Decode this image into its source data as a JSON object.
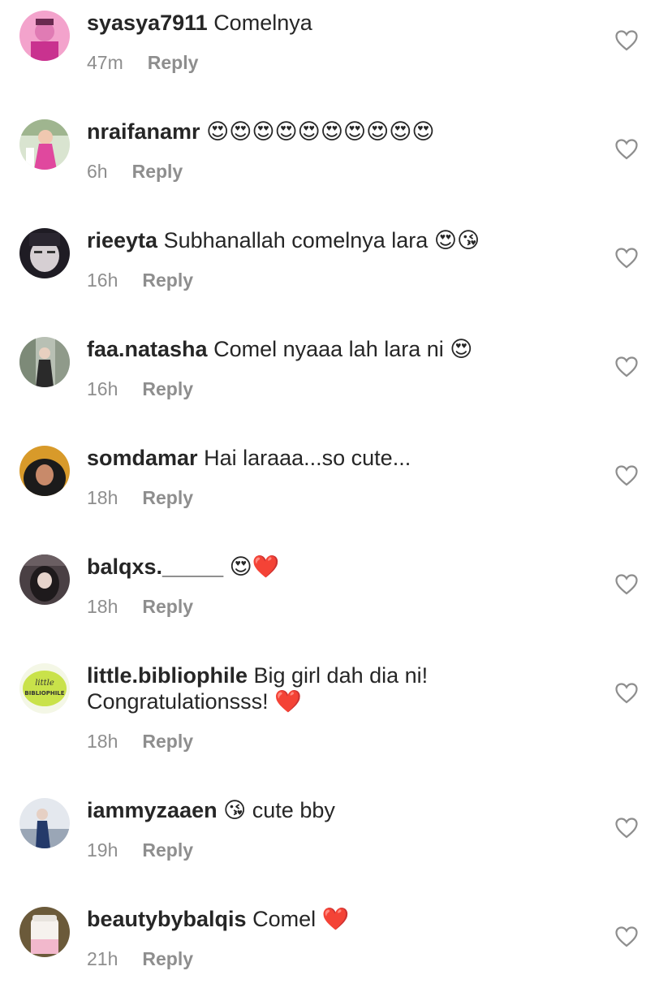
{
  "comments": [
    {
      "username": "syasya7911",
      "text": "Comelnya",
      "emoji": "",
      "time": "47m",
      "reply": "Reply",
      "avatar_color": "#d84fa8"
    },
    {
      "username": "nraifanamr",
      "text": "",
      "emoji": "😍😍😍😍😍😍😍😍😍😍",
      "time": "6h",
      "reply": "Reply",
      "avatar_color": "#c94b8c"
    },
    {
      "username": "rieeyta",
      "text": "Subhanallah comelnya lara",
      "emoji": "😍😘",
      "time": "16h",
      "reply": "Reply",
      "avatar_color": "#2d2a33"
    },
    {
      "username": "faa.natasha",
      "text": "Comel nyaaa lah lara ni",
      "emoji": "😍",
      "time": "16h",
      "reply": "Reply",
      "avatar_color": "#6d7a6a"
    },
    {
      "username": "somdamar",
      "text": "Hai laraaa...so cute...",
      "emoji": "",
      "time": "18h",
      "reply": "Reply",
      "avatar_color": "#c18d2a"
    },
    {
      "username": "balqxs._____",
      "text": "",
      "emoji": "😍❤️",
      "time": "18h",
      "reply": "Reply",
      "avatar_color": "#3b3134"
    },
    {
      "username": "little.bibliophile",
      "text": "Big girl dah dia ni!",
      "text2": "Congratulationsss!",
      "emoji": "❤️",
      "time": "18h",
      "reply": "Reply",
      "avatar_color": "#c7e04a",
      "logo_line1": "little",
      "logo_line2": "BIBLIOPHILE"
    },
    {
      "username": "iammyzaaen",
      "text": "cute bby",
      "emoji": "😘",
      "time": "19h",
      "reply": "Reply",
      "avatar_color": "#7d8fa8"
    },
    {
      "username": "beautybybalqis",
      "text": "Comel",
      "emoji": "❤️",
      "time": "21h",
      "reply": "Reply",
      "avatar_color": "#e9c9d4"
    }
  ],
  "colors": {
    "text": "#262626",
    "meta": "#8e8e8e",
    "heart_outline": "#8e8e8e",
    "emoji_red": "#e0245e"
  },
  "icons": {
    "like": "heart-outline-icon"
  }
}
